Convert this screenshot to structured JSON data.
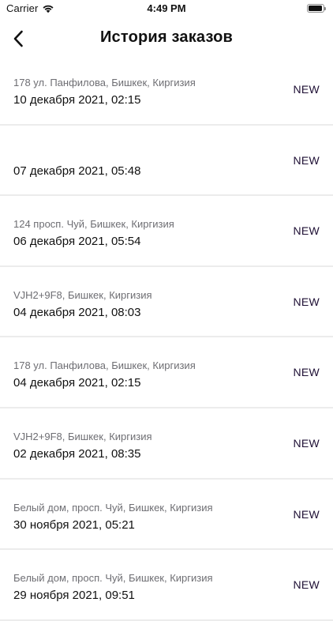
{
  "status_bar": {
    "carrier": "Carrier",
    "time": "4:49 PM"
  },
  "header": {
    "title": "История заказов",
    "back_icon": "chevron-left-icon"
  },
  "orders": [
    {
      "address": "178 ул. Панфилова, Бишкек, Киргизия",
      "date": "10 декабря 2021, 02:15",
      "status": "NEW"
    },
    {
      "address": "",
      "date": "07 декабря 2021, 05:48",
      "status": "NEW"
    },
    {
      "address": "124 просп. Чуй, Бишкек, Киргизия",
      "date": "06 декабря 2021, 05:54",
      "status": "NEW"
    },
    {
      "address": "VJH2+9F8, Бишкек, Киргизия",
      "date": "04 декабря 2021, 08:03",
      "status": "NEW"
    },
    {
      "address": "178 ул. Панфилова, Бишкек, Киргизия",
      "date": "04 декабря 2021, 02:15",
      "status": "NEW"
    },
    {
      "address": "VJH2+9F8, Бишкек, Киргизия",
      "date": "02 декабря 2021, 08:35",
      "status": "NEW"
    },
    {
      "address": "Белый дом, просп. Чуй, Бишкек, Киргизия",
      "date": "30 ноября 2021, 05:21",
      "status": "NEW"
    },
    {
      "address": "Белый дом, просп. Чуй, Бишкек, Киргизия",
      "date": "29 ноября 2021, 09:51",
      "status": "NEW"
    }
  ],
  "colors": {
    "status_text": "#1f1035",
    "address_text": "#6e6e73",
    "divider": "#ececec"
  }
}
